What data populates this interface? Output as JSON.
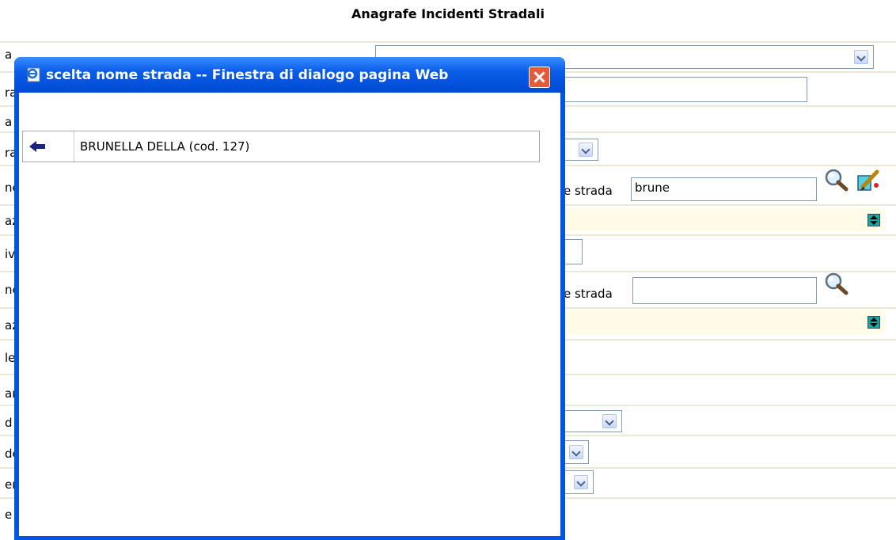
{
  "page": {
    "title": "Anagrafe Incidenti Stradali"
  },
  "left_labels": [
    "a",
    "ra",
    "a",
    "ra",
    "ne",
    "az",
    "iv",
    "ne",
    "az",
    "le",
    "ar",
    "d",
    "de",
    "er",
    "e"
  ],
  "form": {
    "top_select_value": "",
    "strada_label_1": "e strada",
    "strada_value_1": "brune",
    "strada_label_2": "e strada",
    "strada_value_2": ""
  },
  "dialog": {
    "title": "scelta nome strada -- Finestra di dialogo pagina Web",
    "results": [
      {
        "text": "BRUNELLA DELLA (cod. 127)"
      }
    ]
  },
  "icons": {
    "dialog_icon": "ie-page-icon",
    "close": "close-icon",
    "select_arrow": "back-arrow-icon",
    "search": "magnifier-icon",
    "edit": "edit-pencil-icon"
  },
  "colors": {
    "titlebar": "#0a5de8",
    "close_button": "#e35b3a",
    "row_separator": "#ece9d8",
    "spin_button": "#19a5a5"
  }
}
